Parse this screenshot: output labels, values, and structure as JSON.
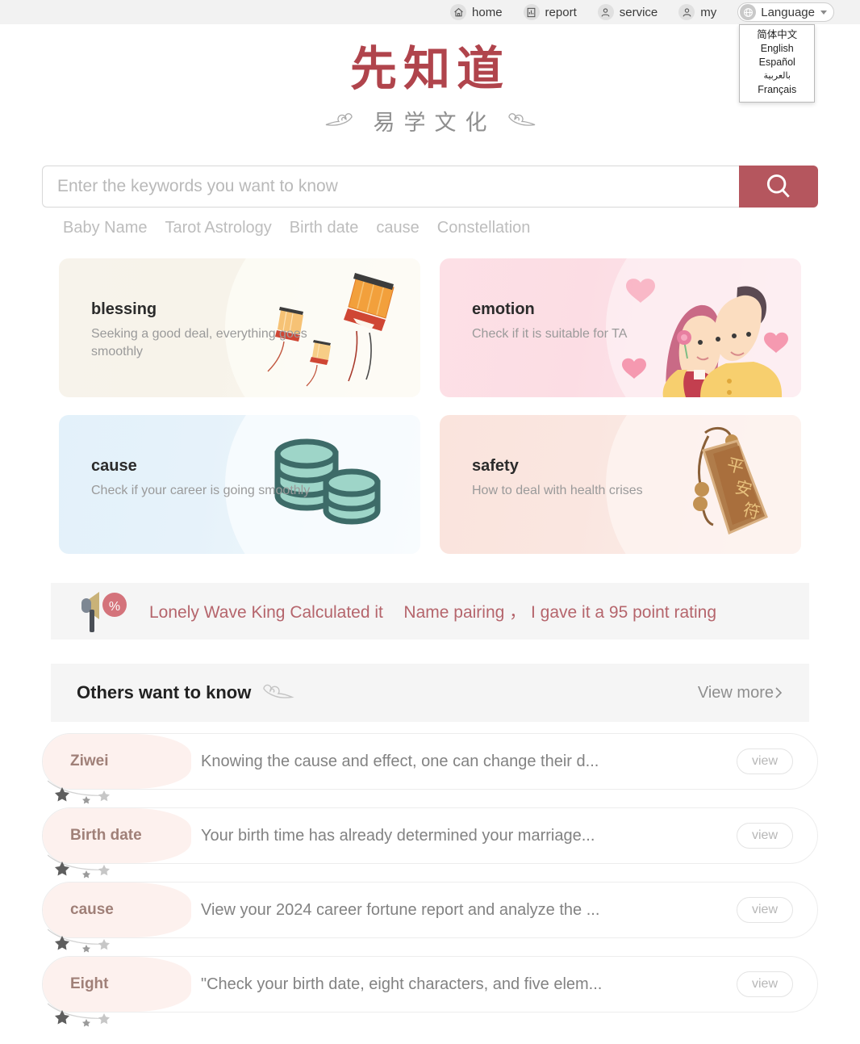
{
  "topnav": {
    "items": [
      {
        "label": "home",
        "icon": "home-icon"
      },
      {
        "label": "report",
        "icon": "report-icon"
      },
      {
        "label": "service",
        "icon": "service-icon"
      },
      {
        "label": "my",
        "icon": "user-icon"
      }
    ],
    "language": {
      "label": "Language",
      "icon": "globe-icon",
      "caret": "chevron-down-icon",
      "options": [
        "简体中文",
        "English",
        "Español",
        "بالعربية",
        "Français"
      ]
    }
  },
  "logo": {
    "main": "先知道",
    "sub": "易学文化",
    "ornament": "cloud-ornament"
  },
  "search": {
    "placeholder": "Enter the keywords you want to know",
    "value": "",
    "button_icon": "search-icon",
    "button_color": "#b5565e",
    "hot_tags": [
      "Baby Name",
      "Tarot Astrology",
      "Birth date",
      "cause",
      "Constellation"
    ]
  },
  "cards": [
    {
      "title": "blessing",
      "desc": "Seeking a good deal, everything goes smoothly",
      "art": "sky-lantern-illustration",
      "color": "#f7f3eb"
    },
    {
      "title": "emotion",
      "desc": "Check if it is suitable for TA",
      "art": "couple-hearts-illustration",
      "color": "#fde0e6"
    },
    {
      "title": "cause",
      "desc": "Check if your career is going smoothly",
      "art": "coin-stack-illustration",
      "color": "#e3f1fa"
    },
    {
      "title": "safety",
      "desc": "How to deal with health crises",
      "art": "peace-amulet-illustration",
      "color": "#fae4dd"
    }
  ],
  "announcement": {
    "icon": "megaphone-percent-icon",
    "part1": "Lonely Wave King Calculated it",
    "part2": "Name pairing",
    "separator": "，",
    "part3": "I gave it a 95 point rating"
  },
  "section": {
    "title": "Others want to know",
    "ornament": "cloud-ornament",
    "more_label": "View more",
    "more_arrow": "chevron-right-icon"
  },
  "list": {
    "rows": [
      {
        "tag": "Ziwei",
        "text": "Knowing the cause and effect, one can change their d...",
        "button": "view"
      },
      {
        "tag": "Birth date",
        "text": "Your birth time has already determined your marriage...",
        "button": "view"
      },
      {
        "tag": "cause",
        "text": "View your 2024 career fortune report and analyze the ...",
        "button": "view"
      },
      {
        "tag": "Eight",
        "text": "\"Check your birth date, eight characters, and five elem...",
        "button": "view"
      }
    ]
  }
}
